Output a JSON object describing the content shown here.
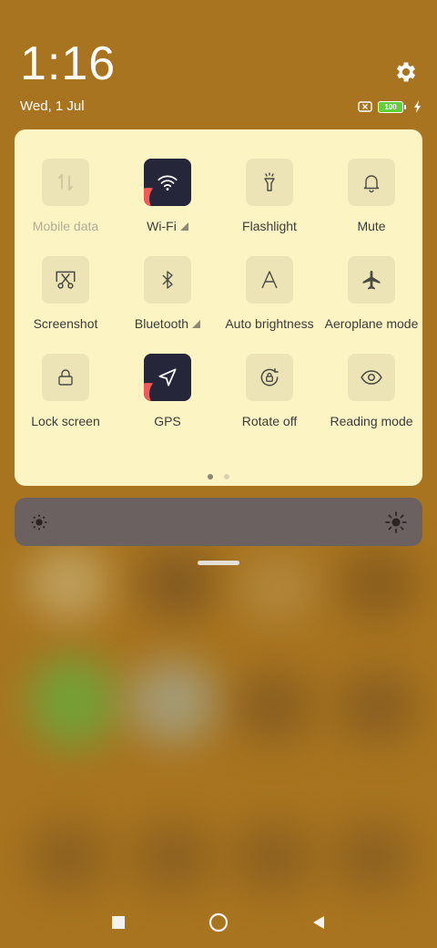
{
  "status": {
    "time": "1:16",
    "date": "Wed, 1 Jul",
    "battery_level": "100",
    "icons": [
      "sim-missing-icon",
      "battery-icon",
      "charging-bolt-icon",
      "gear-icon"
    ]
  },
  "quick_settings": {
    "tiles": [
      {
        "label": "Mobile data",
        "icon": "mobile-data-icon",
        "active": false,
        "disabled": true
      },
      {
        "label": "Wi-Fi",
        "icon": "wifi-icon",
        "active": true
      },
      {
        "label": "Flashlight",
        "icon": "flashlight-icon",
        "active": false
      },
      {
        "label": "Mute",
        "icon": "bell-icon",
        "active": false
      },
      {
        "label": "Screenshot",
        "icon": "scissors-icon",
        "active": false
      },
      {
        "label": "Bluetooth",
        "icon": "bluetooth-icon",
        "active": false
      },
      {
        "label": "Auto brightness",
        "icon": "letter-a-icon",
        "active": false
      },
      {
        "label": "Aeroplane mode",
        "icon": "airplane-icon",
        "active": false
      },
      {
        "label": "Lock screen",
        "icon": "lock-icon",
        "active": false
      },
      {
        "label": "GPS",
        "icon": "location-arrow-icon",
        "active": true
      },
      {
        "label": "Rotate off",
        "icon": "rotate-lock-icon",
        "active": false
      },
      {
        "label": "Reading mode",
        "icon": "eye-icon",
        "active": false
      }
    ],
    "page_count": 2,
    "current_page": 1
  },
  "brightness": {
    "level": 0.0
  },
  "navigation": {
    "buttons": [
      "recents-square-icon",
      "home-circle-icon",
      "back-triangle-icon"
    ]
  },
  "colors": {
    "panel": "#fdf4c4",
    "tile_inactive": "#ece4b6",
    "tile_active": "#26263a",
    "tile_active_accent": "#ef5b5b",
    "brightness_bar": "#6c6161",
    "wallpaper": "#a8741f"
  }
}
